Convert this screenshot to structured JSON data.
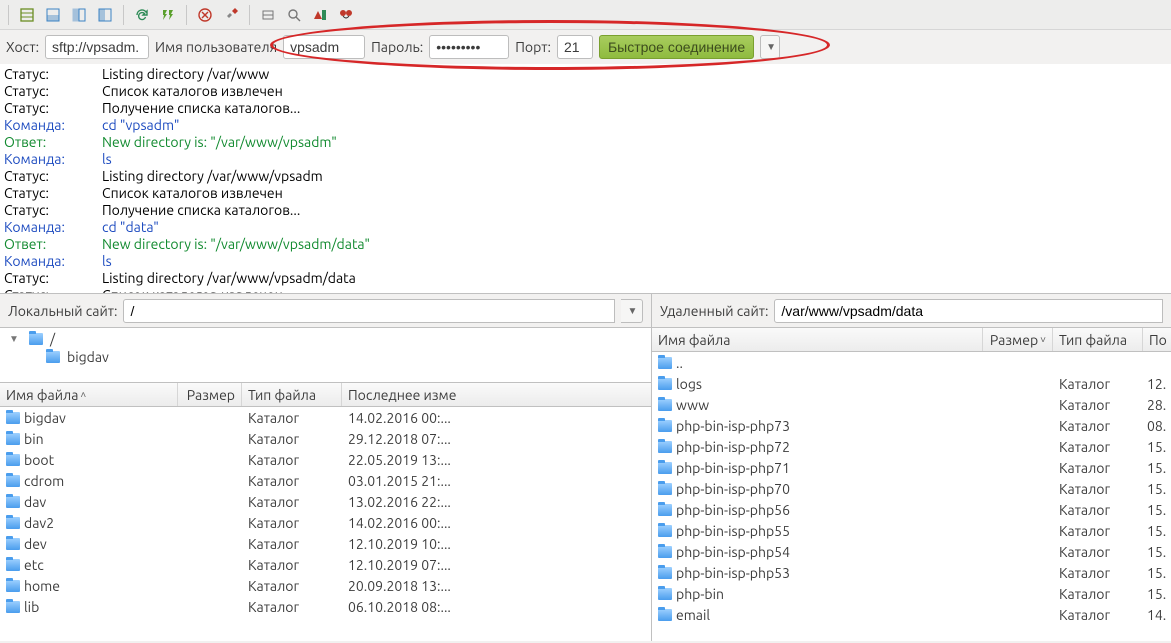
{
  "qc": {
    "host_label": "Хост:",
    "host_value": "sftp://vpsadm.",
    "user_label": "Имя пользователя",
    "user_value": "vpsadm",
    "pass_label": "Пароль:",
    "pass_value": "•••••••••",
    "port_label": "Порт:",
    "port_value": "21",
    "connect_label": "Быстрое соединение"
  },
  "log": [
    {
      "lbl": "Статус:",
      "cls": "c-black",
      "txt": "Listing directory /var/www"
    },
    {
      "lbl": "Статус:",
      "cls": "c-black",
      "txt": "Список каталогов извлечен"
    },
    {
      "lbl": "Статус:",
      "cls": "c-black",
      "txt": "Получение списка каталогов..."
    },
    {
      "lbl": "Команда:",
      "cls": "c-blue",
      "txt": "cd \"vpsadm\""
    },
    {
      "lbl": "Ответ:",
      "cls": "c-green",
      "txt": "New directory is: \"/var/www/vpsadm\""
    },
    {
      "lbl": "Команда:",
      "cls": "c-blue",
      "txt": "ls"
    },
    {
      "lbl": "Статус:",
      "cls": "c-black",
      "txt": "Listing directory /var/www/vpsadm"
    },
    {
      "lbl": "Статус:",
      "cls": "c-black",
      "txt": "Список каталогов извлечен"
    },
    {
      "lbl": "Статус:",
      "cls": "c-black",
      "txt": "Получение списка каталогов..."
    },
    {
      "lbl": "Команда:",
      "cls": "c-blue",
      "txt": "cd \"data\""
    },
    {
      "lbl": "Ответ:",
      "cls": "c-green",
      "txt": "New directory is: \"/var/www/vpsadm/data\""
    },
    {
      "lbl": "Команда:",
      "cls": "c-blue",
      "txt": "ls"
    },
    {
      "lbl": "Статус:",
      "cls": "c-black",
      "txt": "Listing directory /var/www/vpsadm/data"
    },
    {
      "lbl": "Статус:",
      "cls": "c-black",
      "txt": "Список каталогов извлечен"
    }
  ],
  "local": {
    "site_label": "Локальный сайт:",
    "path": "/",
    "tree_root": "/",
    "tree_child": "bigdav",
    "headers": {
      "name": "Имя файла",
      "size": "Размер",
      "type": "Тип файла",
      "date": "Последнее изме"
    },
    "rows": [
      {
        "name": "bigdav",
        "type": "Каталог",
        "date": "14.02.2016 00:..."
      },
      {
        "name": "bin",
        "type": "Каталог",
        "date": "29.12.2018 07:..."
      },
      {
        "name": "boot",
        "type": "Каталог",
        "date": "22.05.2019 13:..."
      },
      {
        "name": "cdrom",
        "type": "Каталог",
        "date": "03.01.2015 21:..."
      },
      {
        "name": "dav",
        "type": "Каталог",
        "date": "13.02.2016 22:..."
      },
      {
        "name": "dav2",
        "type": "Каталог",
        "date": "14.02.2016 00:..."
      },
      {
        "name": "dev",
        "type": "Каталог",
        "date": "12.10.2019 10:..."
      },
      {
        "name": "etc",
        "type": "Каталог",
        "date": "12.10.2019 07:..."
      },
      {
        "name": "home",
        "type": "Каталог",
        "date": "20.09.2018 13:..."
      },
      {
        "name": "lib",
        "type": "Каталог",
        "date": "06.10.2018 08:..."
      }
    ]
  },
  "remote": {
    "site_label": "Удаленный сайт:",
    "path": "/var/www/vpsadm/data",
    "headers": {
      "name": "Имя файла",
      "size": "Размер",
      "type": "Тип файла",
      "misc": "По"
    },
    "rows": [
      {
        "name": "..",
        "type": "",
        "misc": ""
      },
      {
        "name": "logs",
        "type": "Каталог",
        "misc": "12."
      },
      {
        "name": "www",
        "type": "Каталог",
        "misc": "28."
      },
      {
        "name": "php-bin-isp-php73",
        "type": "Каталог",
        "misc": "08."
      },
      {
        "name": "php-bin-isp-php72",
        "type": "Каталог",
        "misc": "15."
      },
      {
        "name": "php-bin-isp-php71",
        "type": "Каталог",
        "misc": "15."
      },
      {
        "name": "php-bin-isp-php70",
        "type": "Каталог",
        "misc": "15."
      },
      {
        "name": "php-bin-isp-php56",
        "type": "Каталог",
        "misc": "15."
      },
      {
        "name": "php-bin-isp-php55",
        "type": "Каталог",
        "misc": "15."
      },
      {
        "name": "php-bin-isp-php54",
        "type": "Каталог",
        "misc": "15."
      },
      {
        "name": "php-bin-isp-php53",
        "type": "Каталог",
        "misc": "15."
      },
      {
        "name": "php-bin",
        "type": "Каталог",
        "misc": "15."
      },
      {
        "name": "email",
        "type": "Каталог",
        "misc": "14."
      }
    ]
  }
}
